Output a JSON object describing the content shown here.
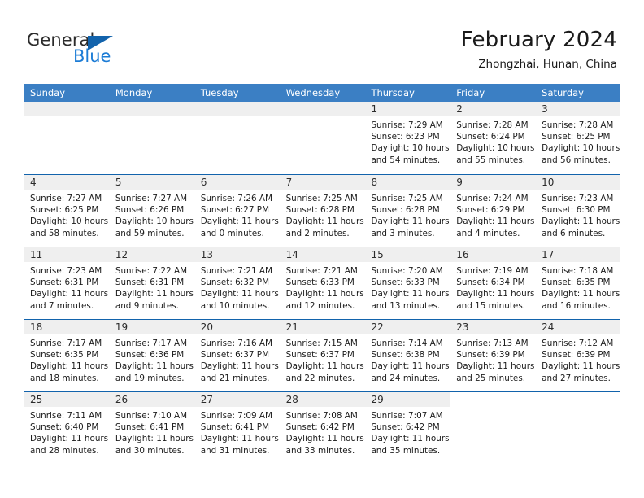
{
  "brand": {
    "name_primary": "General",
    "name_secondary": "Blue",
    "triangle_color": "#1263ac",
    "secondary_color": "#1c7cd6"
  },
  "header": {
    "title": "February 2024",
    "subtitle": "Zhongzhai, Hunan, China"
  },
  "theme": {
    "header_blue": "#3b7fc4",
    "rule_blue": "#1263ac",
    "day_band_gray": "#efefef"
  },
  "calendar": {
    "day_headers": [
      "Sunday",
      "Monday",
      "Tuesday",
      "Wednesday",
      "Thursday",
      "Friday",
      "Saturday"
    ],
    "weeks": [
      [
        {
          "day": "",
          "sunrise": "",
          "sunset": "",
          "daylight_1": "",
          "daylight_2": "",
          "state": "empty"
        },
        {
          "day": "",
          "sunrise": "",
          "sunset": "",
          "daylight_1": "",
          "daylight_2": "",
          "state": "empty"
        },
        {
          "day": "",
          "sunrise": "",
          "sunset": "",
          "daylight_1": "",
          "daylight_2": "",
          "state": "empty"
        },
        {
          "day": "",
          "sunrise": "",
          "sunset": "",
          "daylight_1": "",
          "daylight_2": "",
          "state": "empty"
        },
        {
          "day": "1",
          "sunrise": "Sunrise: 7:29 AM",
          "sunset": "Sunset: 6:23 PM",
          "daylight_1": "Daylight: 10 hours",
          "daylight_2": "and 54 minutes.",
          "state": "filled"
        },
        {
          "day": "2",
          "sunrise": "Sunrise: 7:28 AM",
          "sunset": "Sunset: 6:24 PM",
          "daylight_1": "Daylight: 10 hours",
          "daylight_2": "and 55 minutes.",
          "state": "filled"
        },
        {
          "day": "3",
          "sunrise": "Sunrise: 7:28 AM",
          "sunset": "Sunset: 6:25 PM",
          "daylight_1": "Daylight: 10 hours",
          "daylight_2": "and 56 minutes.",
          "state": "filled"
        }
      ],
      [
        {
          "day": "4",
          "sunrise": "Sunrise: 7:27 AM",
          "sunset": "Sunset: 6:25 PM",
          "daylight_1": "Daylight: 10 hours",
          "daylight_2": "and 58 minutes.",
          "state": "filled"
        },
        {
          "day": "5",
          "sunrise": "Sunrise: 7:27 AM",
          "sunset": "Sunset: 6:26 PM",
          "daylight_1": "Daylight: 10 hours",
          "daylight_2": "and 59 minutes.",
          "state": "filled"
        },
        {
          "day": "6",
          "sunrise": "Sunrise: 7:26 AM",
          "sunset": "Sunset: 6:27 PM",
          "daylight_1": "Daylight: 11 hours",
          "daylight_2": "and 0 minutes.",
          "state": "filled"
        },
        {
          "day": "7",
          "sunrise": "Sunrise: 7:25 AM",
          "sunset": "Sunset: 6:28 PM",
          "daylight_1": "Daylight: 11 hours",
          "daylight_2": "and 2 minutes.",
          "state": "filled"
        },
        {
          "day": "8",
          "sunrise": "Sunrise: 7:25 AM",
          "sunset": "Sunset: 6:28 PM",
          "daylight_1": "Daylight: 11 hours",
          "daylight_2": "and 3 minutes.",
          "state": "filled"
        },
        {
          "day": "9",
          "sunrise": "Sunrise: 7:24 AM",
          "sunset": "Sunset: 6:29 PM",
          "daylight_1": "Daylight: 11 hours",
          "daylight_2": "and 4 minutes.",
          "state": "filled"
        },
        {
          "day": "10",
          "sunrise": "Sunrise: 7:23 AM",
          "sunset": "Sunset: 6:30 PM",
          "daylight_1": "Daylight: 11 hours",
          "daylight_2": "and 6 minutes.",
          "state": "filled"
        }
      ],
      [
        {
          "day": "11",
          "sunrise": "Sunrise: 7:23 AM",
          "sunset": "Sunset: 6:31 PM",
          "daylight_1": "Daylight: 11 hours",
          "daylight_2": "and 7 minutes.",
          "state": "filled"
        },
        {
          "day": "12",
          "sunrise": "Sunrise: 7:22 AM",
          "sunset": "Sunset: 6:31 PM",
          "daylight_1": "Daylight: 11 hours",
          "daylight_2": "and 9 minutes.",
          "state": "filled"
        },
        {
          "day": "13",
          "sunrise": "Sunrise: 7:21 AM",
          "sunset": "Sunset: 6:32 PM",
          "daylight_1": "Daylight: 11 hours",
          "daylight_2": "and 10 minutes.",
          "state": "filled"
        },
        {
          "day": "14",
          "sunrise": "Sunrise: 7:21 AM",
          "sunset": "Sunset: 6:33 PM",
          "daylight_1": "Daylight: 11 hours",
          "daylight_2": "and 12 minutes.",
          "state": "filled"
        },
        {
          "day": "15",
          "sunrise": "Sunrise: 7:20 AM",
          "sunset": "Sunset: 6:33 PM",
          "daylight_1": "Daylight: 11 hours",
          "daylight_2": "and 13 minutes.",
          "state": "filled"
        },
        {
          "day": "16",
          "sunrise": "Sunrise: 7:19 AM",
          "sunset": "Sunset: 6:34 PM",
          "daylight_1": "Daylight: 11 hours",
          "daylight_2": "and 15 minutes.",
          "state": "filled"
        },
        {
          "day": "17",
          "sunrise": "Sunrise: 7:18 AM",
          "sunset": "Sunset: 6:35 PM",
          "daylight_1": "Daylight: 11 hours",
          "daylight_2": "and 16 minutes.",
          "state": "filled"
        }
      ],
      [
        {
          "day": "18",
          "sunrise": "Sunrise: 7:17 AM",
          "sunset": "Sunset: 6:35 PM",
          "daylight_1": "Daylight: 11 hours",
          "daylight_2": "and 18 minutes.",
          "state": "filled"
        },
        {
          "day": "19",
          "sunrise": "Sunrise: 7:17 AM",
          "sunset": "Sunset: 6:36 PM",
          "daylight_1": "Daylight: 11 hours",
          "daylight_2": "and 19 minutes.",
          "state": "filled"
        },
        {
          "day": "20",
          "sunrise": "Sunrise: 7:16 AM",
          "sunset": "Sunset: 6:37 PM",
          "daylight_1": "Daylight: 11 hours",
          "daylight_2": "and 21 minutes.",
          "state": "filled"
        },
        {
          "day": "21",
          "sunrise": "Sunrise: 7:15 AM",
          "sunset": "Sunset: 6:37 PM",
          "daylight_1": "Daylight: 11 hours",
          "daylight_2": "and 22 minutes.",
          "state": "filled"
        },
        {
          "day": "22",
          "sunrise": "Sunrise: 7:14 AM",
          "sunset": "Sunset: 6:38 PM",
          "daylight_1": "Daylight: 11 hours",
          "daylight_2": "and 24 minutes.",
          "state": "filled"
        },
        {
          "day": "23",
          "sunrise": "Sunrise: 7:13 AM",
          "sunset": "Sunset: 6:39 PM",
          "daylight_1": "Daylight: 11 hours",
          "daylight_2": "and 25 minutes.",
          "state": "filled"
        },
        {
          "day": "24",
          "sunrise": "Sunrise: 7:12 AM",
          "sunset": "Sunset: 6:39 PM",
          "daylight_1": "Daylight: 11 hours",
          "daylight_2": "and 27 minutes.",
          "state": "filled"
        }
      ],
      [
        {
          "day": "25",
          "sunrise": "Sunrise: 7:11 AM",
          "sunset": "Sunset: 6:40 PM",
          "daylight_1": "Daylight: 11 hours",
          "daylight_2": "and 28 minutes.",
          "state": "filled"
        },
        {
          "day": "26",
          "sunrise": "Sunrise: 7:10 AM",
          "sunset": "Sunset: 6:41 PM",
          "daylight_1": "Daylight: 11 hours",
          "daylight_2": "and 30 minutes.",
          "state": "filled"
        },
        {
          "day": "27",
          "sunrise": "Sunrise: 7:09 AM",
          "sunset": "Sunset: 6:41 PM",
          "daylight_1": "Daylight: 11 hours",
          "daylight_2": "and 31 minutes.",
          "state": "filled"
        },
        {
          "day": "28",
          "sunrise": "Sunrise: 7:08 AM",
          "sunset": "Sunset: 6:42 PM",
          "daylight_1": "Daylight: 11 hours",
          "daylight_2": "and 33 minutes.",
          "state": "filled"
        },
        {
          "day": "29",
          "sunrise": "Sunrise: 7:07 AM",
          "sunset": "Sunset: 6:42 PM",
          "daylight_1": "Daylight: 11 hours",
          "daylight_2": "and 35 minutes.",
          "state": "filled"
        },
        {
          "day": "",
          "sunrise": "",
          "sunset": "",
          "daylight_1": "",
          "daylight_2": "",
          "state": "blank"
        },
        {
          "day": "",
          "sunrise": "",
          "sunset": "",
          "daylight_1": "",
          "daylight_2": "",
          "state": "blank"
        }
      ]
    ]
  }
}
